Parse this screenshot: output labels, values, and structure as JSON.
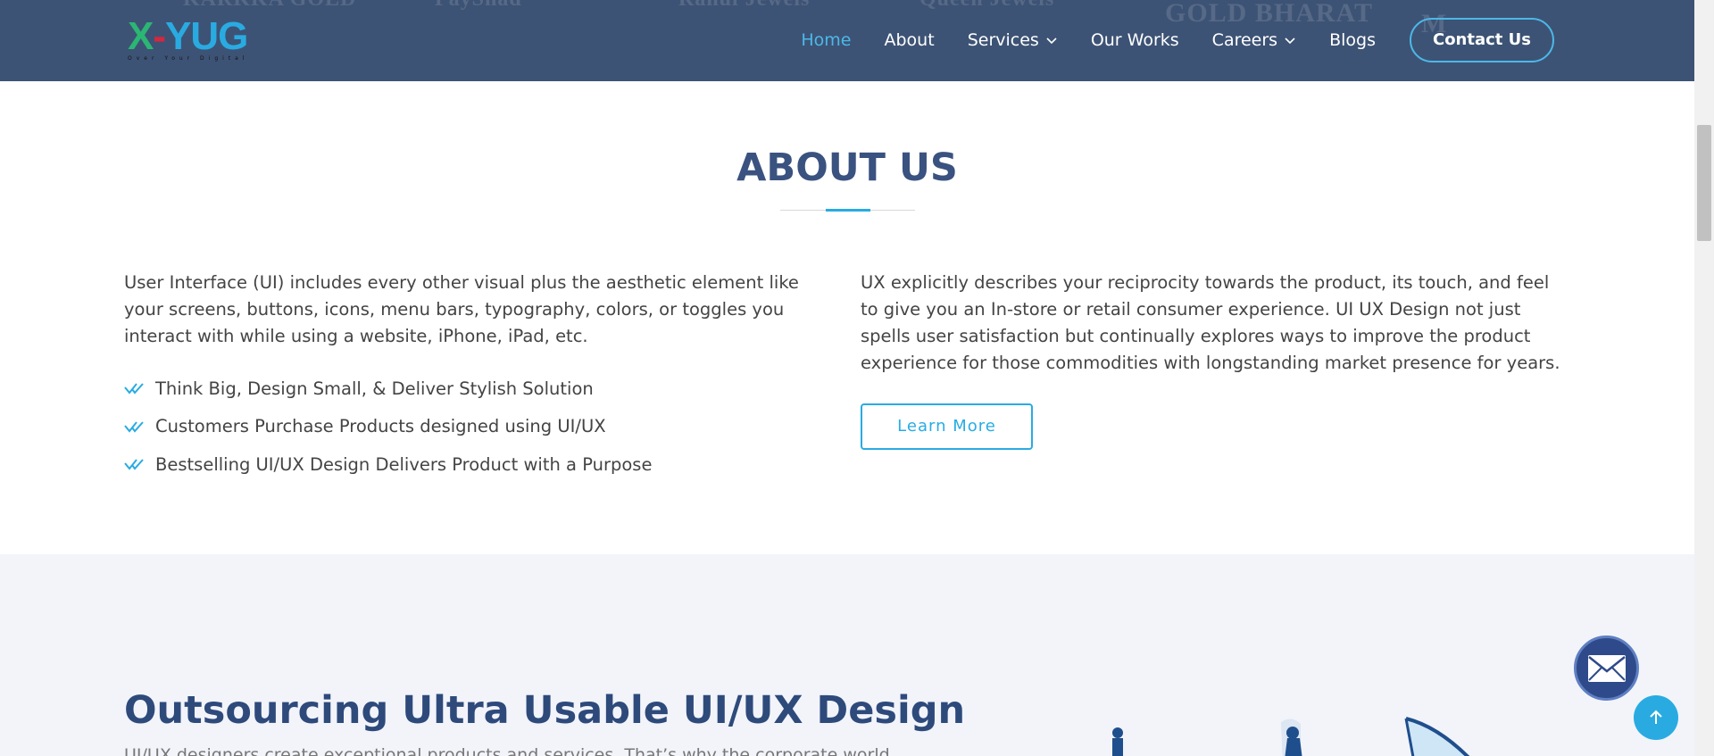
{
  "header": {
    "brand": {
      "x": "X",
      "dash": "-",
      "rest": "YUG",
      "tagline": "Over Your Digital"
    },
    "partner_logos": [
      "KARKKA GOLD",
      "PayShad",
      "Rahul Jewels",
      "Queen Jewels",
      "GOLD BHARAT",
      "M"
    ],
    "nav": [
      {
        "label": "Home",
        "active": true,
        "dropdown": false
      },
      {
        "label": "About",
        "active": false,
        "dropdown": false
      },
      {
        "label": "Services",
        "active": false,
        "dropdown": true
      },
      {
        "label": "Our Works",
        "active": false,
        "dropdown": false
      },
      {
        "label": "Careers",
        "active": false,
        "dropdown": true
      },
      {
        "label": "Blogs",
        "active": false,
        "dropdown": false
      }
    ],
    "contact_label": "Contact Us"
  },
  "about": {
    "title": "ABOUT US",
    "left_paragraph": "User Interface (UI) includes every other visual plus the aesthetic element like your screens, buttons, icons, menu bars, typography, colors, or toggles you interact with while using a website, iPhone, iPad, etc.",
    "bullets": [
      "Think Big, Design Small, & Deliver Stylish Solution",
      "Customers Purchase Products designed using UI/UX",
      "Bestselling UI/UX Design Delivers Product with a Purpose"
    ],
    "right_paragraph": "UX explicitly describes your reciprocity towards the product, its touch, and feel to give you an In-store or retail consumer experience. UI UX Design not just spells user satisfaction but continually explores ways to improve the product experience for those commodities with longstanding market presence for years.",
    "learn_more_label": "Learn More"
  },
  "outsourcing": {
    "title": "Outsourcing Ultra Usable UI/UX Design",
    "subtitle": "UI/UX designers create exceptional products and services. That’s why the corporate world"
  },
  "colors": {
    "header_bg": "#3d5375",
    "accent": "#29abe2",
    "heading": "#3a5280",
    "section_bg": "#f2f4fa"
  },
  "icons": {
    "bullet": "double-check-icon",
    "mail": "envelope-icon",
    "back_to_top": "arrow-up-icon",
    "dropdown": "chevron-down-icon"
  }
}
